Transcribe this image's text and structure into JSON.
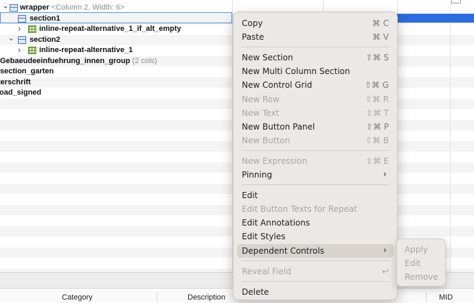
{
  "tree": {
    "rows": [
      {
        "name": "tree-row-wrapper",
        "chevron": "down",
        "icon": "section",
        "label": "wrapper",
        "meta": "<Column 2, Width: 6>"
      },
      {
        "name": "tree-row-section1",
        "chevron": "",
        "icon": "section",
        "label": "section1",
        "meta": "",
        "selected": true
      },
      {
        "name": "tree-row-inline-repeat-if-alt-empty",
        "chevron": "right",
        "icon": "grid",
        "label": "inline-repeat-alternative_1_if_alt_empty",
        "meta": ""
      },
      {
        "name": "tree-row-section2",
        "chevron": "down",
        "icon": "section",
        "label": "section2",
        "meta": ""
      },
      {
        "name": "tree-row-inline-repeat",
        "chevron": "right",
        "icon": "grid",
        "label": "inline-repeat-alternative_1",
        "meta": ""
      },
      {
        "name": "tree-row-gebaeude",
        "chevron": "",
        "icon": "",
        "label": "Gebaeudeeinfuehrung_innen_group",
        "meta": "(2 cols)"
      },
      {
        "name": "tree-row-section-garten",
        "chevron": "",
        "icon": "",
        "label": "section_garten",
        "meta": ""
      },
      {
        "name": "tree-row-unterschrift",
        "chevron": "",
        "icon": "",
        "label": "terschrift",
        "meta": ""
      },
      {
        "name": "tree-row-upload-signed",
        "chevron": "",
        "icon": "",
        "label": "oad_signed",
        "meta": ""
      }
    ]
  },
  "columns": {
    "category": "Category",
    "description": "Description",
    "mid": "MID"
  },
  "context_menu": {
    "items": [
      {
        "label": "Copy",
        "shortcut": "⌘ C",
        "enabled": true
      },
      {
        "label": "Paste",
        "shortcut": "⌘ V",
        "enabled": true
      },
      {
        "sep": true
      },
      {
        "label": "New Section",
        "shortcut": "⇧⌘ S",
        "enabled": true
      },
      {
        "label": "New Multi Column Section",
        "shortcut": "",
        "enabled": true
      },
      {
        "label": "New Control Grid",
        "shortcut": "⇧⌘ G",
        "enabled": true
      },
      {
        "label": "New Row",
        "shortcut": "⇧⌘ R",
        "enabled": false
      },
      {
        "label": "New Text",
        "shortcut": "⇧⌘ T",
        "enabled": false
      },
      {
        "label": "New Button Panel",
        "shortcut": "⇧⌘ P",
        "enabled": true
      },
      {
        "label": "New Button",
        "shortcut": "⇧⌘ B",
        "enabled": false
      },
      {
        "sep": true
      },
      {
        "label": "New Expression",
        "shortcut": "⇧⌘ E",
        "enabled": false
      },
      {
        "label": "Pinning",
        "shortcut": "",
        "enabled": true,
        "submenu": true
      },
      {
        "sep": true
      },
      {
        "label": "Edit",
        "shortcut": "",
        "enabled": true
      },
      {
        "label": "Edit Button Texts for Repeat",
        "shortcut": "",
        "enabled": false
      },
      {
        "label": "Edit Annotations",
        "shortcut": "",
        "enabled": true
      },
      {
        "label": "Edit Styles",
        "shortcut": "",
        "enabled": true
      },
      {
        "label": "Dependent Controls",
        "shortcut": "",
        "enabled": true,
        "submenu": true,
        "highlighted": true
      },
      {
        "sep": true
      },
      {
        "label": "Reveal Field",
        "shortcut": "↩",
        "enabled": false
      },
      {
        "sep": true
      },
      {
        "label": "Delete",
        "shortcut": "",
        "enabled": true
      }
    ]
  },
  "submenu": {
    "items": [
      "Apply",
      "Edit",
      "Remove"
    ]
  },
  "colors": {
    "selection": "#2a6de0",
    "menu_bg": "#ebe8e5",
    "disabled_text": "#a9a5a2"
  }
}
